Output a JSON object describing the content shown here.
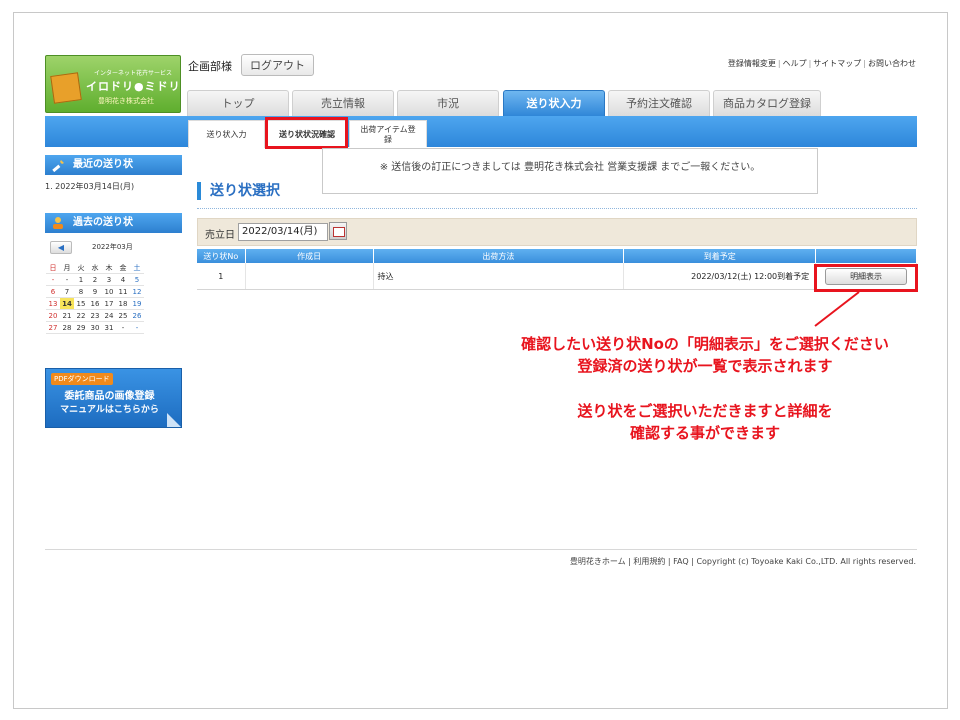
{
  "logo": {
    "tagline": "インターネット花卉サービス",
    "name": "イロドリ●ミドリ",
    "company": "豊明花き株式会社"
  },
  "header": {
    "user": "企画部様",
    "logout_label": "ログアウト",
    "top_links": [
      "登録情報変更",
      "ヘルプ",
      "サイトマップ",
      "お問い合わせ"
    ]
  },
  "main_tabs": [
    {
      "label": "トップ",
      "active": false
    },
    {
      "label": "売立情報",
      "active": false
    },
    {
      "label": "市況",
      "active": false
    },
    {
      "label": "送り状入力",
      "active": true
    },
    {
      "label": "予約注文確認",
      "active": false
    },
    {
      "label": "商品カタログ登録",
      "active": false
    }
  ],
  "sub_tabs": [
    {
      "label": "送り状入力",
      "selected": false
    },
    {
      "label": "送り状状況確認",
      "selected": true
    },
    {
      "label": "出荷アイテム登録",
      "selected": false
    }
  ],
  "sidebar": {
    "recent_title": "最近の送り状",
    "recent_item": "1. 2022年03月14日(月)",
    "past_title": "過去の送り状",
    "calendar_month": "2022年03月",
    "calendar_prev_arrow": "◀",
    "calendar_header": [
      "日",
      "月",
      "火",
      "水",
      "木",
      "金",
      "土"
    ],
    "calendar_rows": [
      [
        "-",
        "-",
        "1",
        "2",
        "3",
        "4",
        "5"
      ],
      [
        "6",
        "7",
        "8",
        "9",
        "10",
        "11",
        "12"
      ],
      [
        "13",
        "14",
        "15",
        "16",
        "17",
        "18",
        "19"
      ],
      [
        "20",
        "21",
        "22",
        "23",
        "24",
        "25",
        "26"
      ],
      [
        "27",
        "28",
        "29",
        "30",
        "31",
        "-",
        "-"
      ]
    ],
    "calendar_today": "14",
    "pdf_tag": "PDFダウンロード",
    "pdf_line1": "委託商品の画像登録",
    "pdf_line2": "マニュアルはこちらから"
  },
  "main": {
    "notice": "※ 送信後の訂正につきましては 豊明花き株式会社 営業支援課 までご一報ください。",
    "page_title": "送り状選択",
    "date_label": "売立日",
    "date_value": "2022/03/14(月)",
    "table": {
      "headers": [
        "送り状No",
        "作成日",
        "出荷方法",
        "到着予定",
        ""
      ],
      "rows": [
        {
          "no": "1",
          "created": "",
          "method": "持込",
          "arrival": "2022/03/12(土) 12:00到着予定",
          "button": "明細表示"
        }
      ]
    }
  },
  "annotation": {
    "line1": "確認したい送り状Noの「明細表示」をご選択ください",
    "line2": "登録済の送り状が一覧で表示されます",
    "line3": "送り状をご選択いただきますと詳細を",
    "line4": "確認する事ができます"
  },
  "footer": {
    "links": [
      "豊明花きホーム",
      "利用規約",
      "FAQ"
    ],
    "copyright": "Copyright (c) Toyoake Kaki Co.,LTD. All rights reserved."
  },
  "colors": {
    "accent_blue": "#2d86da",
    "highlight_red": "#e8141e",
    "today_yellow": "#f7e35a"
  }
}
